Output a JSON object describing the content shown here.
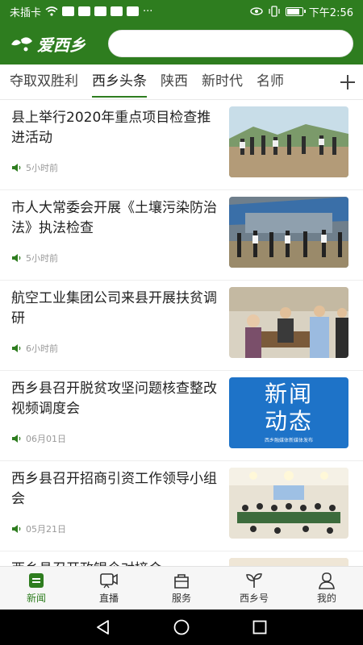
{
  "status_bar": {
    "carrier": "未插卡",
    "time": "下午2:56",
    "battery_level": 0.85
  },
  "header": {
    "app_name": "爱西乡",
    "search_placeholder": ""
  },
  "tabs": [
    {
      "label": "夺取双胜利",
      "active": false
    },
    {
      "label": "西乡头条",
      "active": true
    },
    {
      "label": "陕西",
      "active": false
    },
    {
      "label": "新时代",
      "active": false
    },
    {
      "label": "名师",
      "active": false
    }
  ],
  "news": [
    {
      "title": "县上举行2020年重点项目检查推进活动",
      "time": "5小时前",
      "thumb": "outdoor-inspection-photo"
    },
    {
      "title": "市人大常委会开展《土壤污染防治法》执法检查",
      "time": "5小时前",
      "thumb": "factory-inspection-photo"
    },
    {
      "title": "航空工业集团公司来县开展扶贫调研",
      "time": "6小时前",
      "thumb": "exhibition-visit-photo"
    },
    {
      "title": "西乡县召开脱贫攻坚问题核查整改视频调度会",
      "time": "06月01日",
      "thumb": "news-card",
      "card": {
        "line1": "新闻",
        "line2": "动态",
        "footer": "西乡融媒体新媒体发布"
      }
    },
    {
      "title": "西乡县召开招商引资工作领导小组会",
      "time": "05月21日",
      "thumb": "meeting-room-photo"
    },
    {
      "title": "西乡县召开政银企对接会",
      "time": "",
      "thumb": "partial-photo"
    }
  ],
  "bottom_nav": [
    {
      "label": "新闻",
      "icon": "news-icon",
      "active": true
    },
    {
      "label": "直播",
      "icon": "live-icon",
      "active": false
    },
    {
      "label": "服务",
      "icon": "service-icon",
      "active": false
    },
    {
      "label": "西乡号",
      "icon": "sprout-icon",
      "active": false
    },
    {
      "label": "我的",
      "icon": "profile-icon",
      "active": false
    }
  ],
  "colors": {
    "brand_green": "#2e7d1f",
    "news_card_blue": "#1e73c8"
  }
}
